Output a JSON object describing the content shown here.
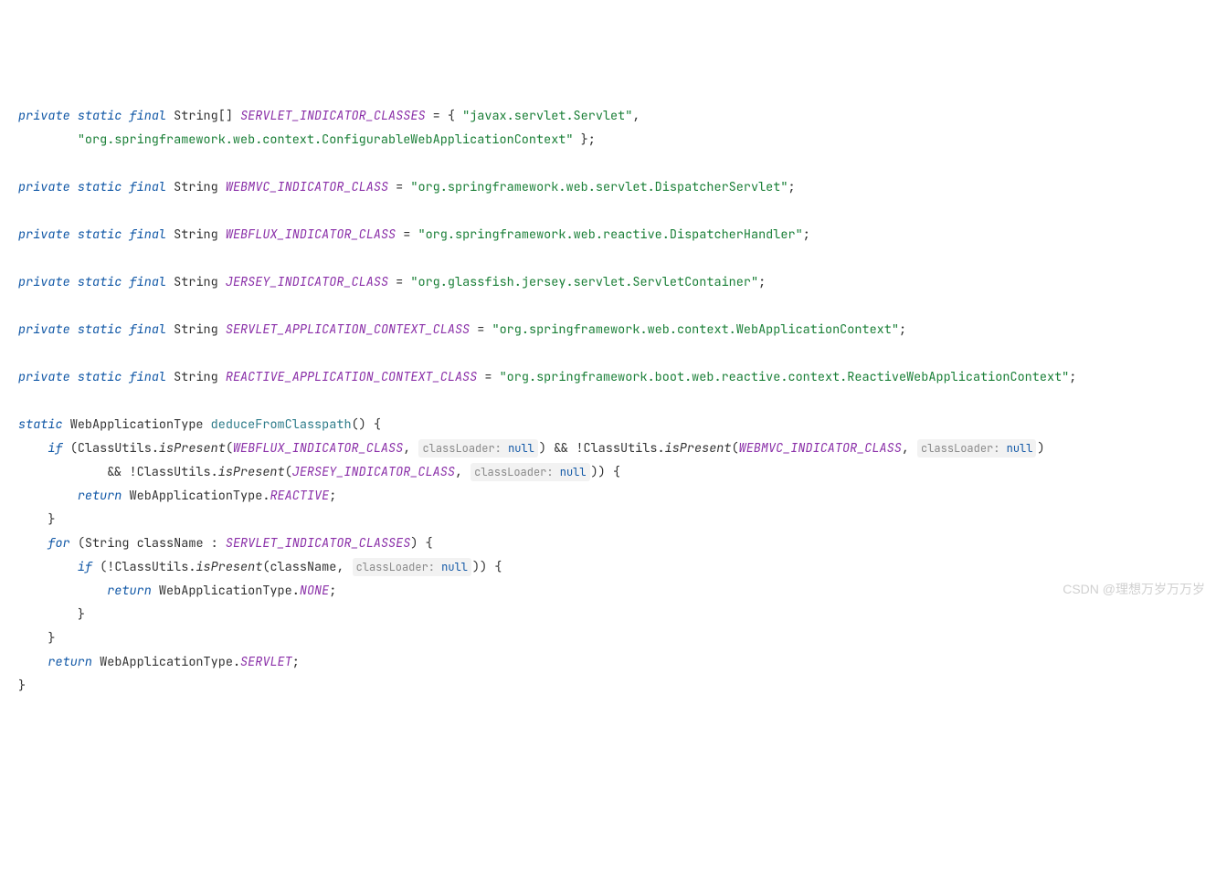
{
  "kw_private": "private",
  "kw_static": "static",
  "kw_final": "final",
  "kw_if": "if",
  "kw_for": "for",
  "kw_return": "return",
  "kw_null": "null",
  "t_string": "String",
  "t_string_arr": "String[]",
  "t_wat": "WebApplicationType",
  "t_cu": "ClassUtils",
  "c_servlet_ind": "SERVLET_INDICATOR_CLASSES",
  "c_webmvc": "WEBMVC_INDICATOR_CLASS",
  "c_webflux": "WEBFLUX_INDICATOR_CLASS",
  "c_jersey": "JERSEY_INDICATOR_CLASS",
  "c_servlet_app": "SERVLET_APPLICATION_CONTEXT_CLASS",
  "c_reactive_app": "REACTIVE_APPLICATION_CONTEXT_CLASS",
  "c_reactive": "REACTIVE",
  "c_none": "NONE",
  "c_servlet": "SERVLET",
  "s_javax_servlet": "\"javax.servlet.Servlet\"",
  "s_configurable": "\"org.springframework.web.context.ConfigurableWebApplicationContext\"",
  "s_dispatcher_servlet": "\"org.springframework.web.servlet.DispatcherServlet\"",
  "s_dispatcher_handler": "\"org.springframework.web.reactive.DispatcherHandler\"",
  "s_jersey": "\"org.glassfish.jersey.servlet.ServletContainer\"",
  "s_web_app_ctx": "\"org.springframework.web.context.WebApplicationContext\"",
  "s_reactive_ctx": "\"org.springframework.boot.web.reactive.context.ReactiveWebApplicationContext\"",
  "m_deduce": "deduceFromClasspath",
  "m_ispresent": "isPresent",
  "v_classname": "className",
  "hint_prefix": "classLoader: ",
  "watermark": "CSDN @理想万岁万万岁"
}
